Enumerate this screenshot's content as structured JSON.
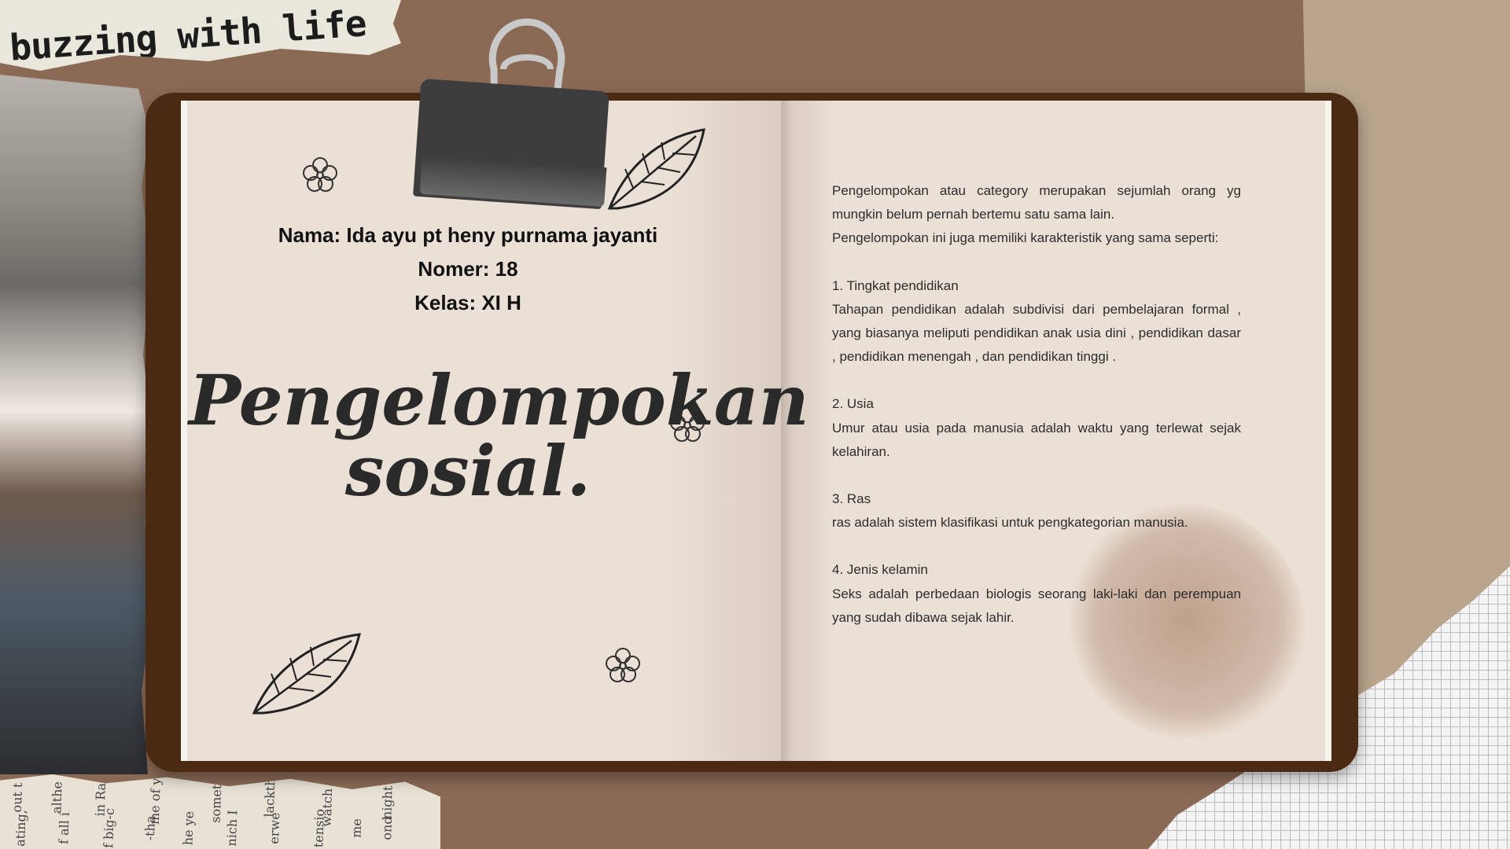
{
  "background": {
    "tape_label": "buzzing with life",
    "newspaper_words": [
      "out t",
      "althe",
      "in Rai",
      "me of ye",
      "somethi",
      "lackth",
      "watch tic",
      "night r",
      "ating,",
      "f all i",
      "f big-c",
      "-tha",
      "he ye",
      "nich I",
      "erwe",
      "tensio",
      "me",
      "ond"
    ]
  },
  "student": {
    "name": "Nama: Ida ayu pt heny purnama jayanti",
    "number": "Nomer: 18",
    "class": "Kelas: XI H"
  },
  "title": {
    "line1": "Pengelompokan",
    "line2": "sosial."
  },
  "content": {
    "intro1": "Pengelompokan atau category merupakan sejumlah orang yg mungkin belum pernah bertemu satu sama lain.",
    "intro2": "Pengelompokan ini juga memiliki karakteristik yang sama seperti:",
    "sections": [
      {
        "heading": "1. Tingkat pendidikan",
        "body": "Tahapan pendidikan adalah subdivisi dari pembelajaran formal , yang biasanya meliputi pendidikan anak usia dini , pendidikan dasar , pendidikan menengah , dan pendidikan tinggi ."
      },
      {
        "heading": "2. Usia",
        "body": "Umur atau usia pada manusia adalah waktu yang terlewat sejak kelahiran."
      },
      {
        "heading": "3. Ras",
        "body": "ras adalah sistem klasifikasi untuk pengkategorian manusia."
      },
      {
        "heading": "4. Jenis kelamin",
        "body": "Seks adalah perbedaan biologis seorang laki-laki dan perempuan yang sudah dibawa sejak lahir."
      }
    ]
  },
  "icons": {
    "leaf": "leaf-icon",
    "flower": "flower-icon",
    "clip": "binder-clip-icon"
  }
}
